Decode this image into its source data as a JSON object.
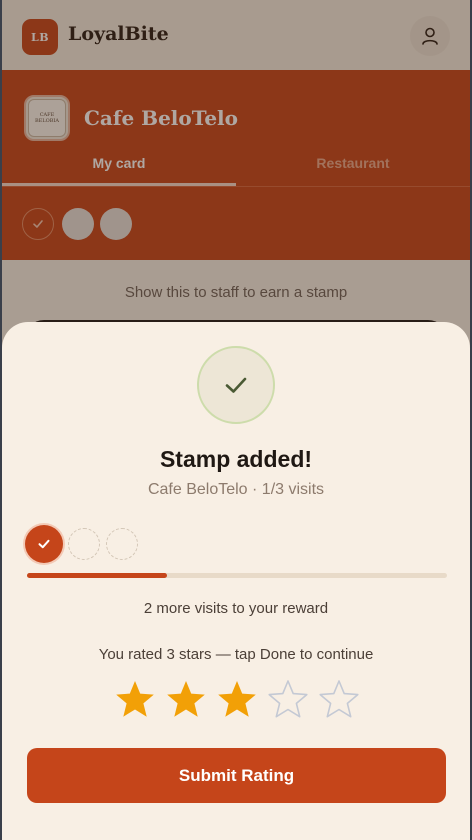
{
  "app": {
    "logo_text": "LB",
    "brand_name": "LoyalBite",
    "profile_icon": "user-icon"
  },
  "restaurant": {
    "name": "Cafe BeloTelo",
    "logo_lines": [
      "CAFE",
      "BELOBIA"
    ],
    "tabs": [
      {
        "label": "My card",
        "active": true
      },
      {
        "label": "Restaurant",
        "active": false
      }
    ],
    "stamps": {
      "collected": 1,
      "total": 3
    }
  },
  "card": {
    "hint": "Show this to staff to earn a stamp"
  },
  "sheet": {
    "title": "Stamp added!",
    "subtitle": "Cafe BeloTelo · 1/3 visits",
    "progress_fraction": 0.333,
    "remaining": "2 more visits to your reward",
    "rated": "You rated 3 stars — tap Done to continue",
    "rating": 3,
    "rating_max": 5,
    "submit_label": "Submit Rating"
  },
  "colors": {
    "accent": "#c5451a",
    "star_filled": "#f2a007",
    "star_empty": "#c4c9d4",
    "sheet_bg": "#f8efe4"
  }
}
